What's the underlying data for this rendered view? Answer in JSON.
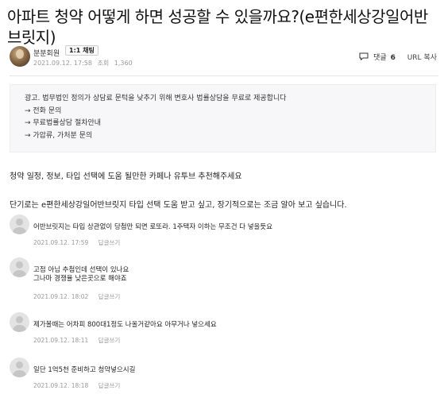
{
  "post": {
    "title": "아파트 청약 어떻게 하면 성공할 수 있을까요?(e편한세상강일어반브릿지)",
    "author": {
      "name": "분분회원",
      "badge": "1:1 채팅",
      "date": "2021.09.12. 17:58",
      "views_label": "조회",
      "views": "1,360"
    },
    "actions": {
      "comment_label": "댓글",
      "comment_count": "6",
      "copy_url_label": "URL 복사"
    },
    "ad": {
      "lines": [
        "광고. 법무법인 정의가 상담료 문턱을 낮추기 위해 변호사 법률상담을 무료로 제공합니다",
        "→ 전화 문의",
        "→ 무료법률상담 절차안내",
        "→ 가압류, 가처분 문의"
      ]
    },
    "body": [
      "청약 일정, 정보, 타입 선택에 도움 될만한 카페나 유투브 추천해주세요",
      "단기로는 e편한세상강일어반브릿지 타입 선택 도움 받고 싶고, 장기적으로는 조금 알아 보고 싶습니다."
    ]
  },
  "comments": [
    {
      "lines": [
        "어반브릿지는 타입 상관없이 당첨만 되면 로또라. 1주택자 이하는 무조건 다 넣을듯요"
      ],
      "date": "2021.09.12. 17:59",
      "reply": "답글쓰기"
    },
    {
      "lines": [
        "고점 아님 추첨인데 선택이 있나요",
        "그나마 경쟁율 낮은곳으로 해야죠"
      ],
      "date": "2021.09.12. 18:02",
      "reply": "답글쓰기"
    },
    {
      "lines": [
        "제가볼때는 어차피 800대1정도 나올거같아요 아무거나 넣으세요"
      ],
      "date": "2021.09.12. 18:11",
      "reply": "답글쓰기"
    },
    {
      "lines": [
        "일단 1억5천 준비하고 청약넣으시길"
      ],
      "date": "2021.09.12. 18:18",
      "reply": "답글쓰기"
    }
  ]
}
